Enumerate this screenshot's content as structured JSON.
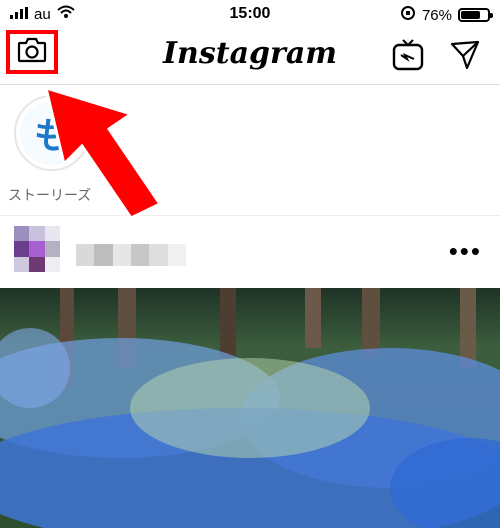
{
  "status_bar": {
    "carrier": "au",
    "time": "15:00",
    "battery_percent": "76%",
    "battery_level": 0.76,
    "icons": [
      "signal-icon",
      "wifi-icon",
      "orientation-lock-icon",
      "battery-icon"
    ]
  },
  "nav": {
    "title": "Instagram",
    "icons": [
      "camera-icon",
      "igtv-icon",
      "direct-message-icon"
    ]
  },
  "stories": {
    "items": [
      {
        "label": "ストーリーズ"
      }
    ]
  },
  "post": {
    "more_label": "•••"
  },
  "colors": {
    "highlight": "#ff0000",
    "story_ring": "#e6e6e6",
    "brand_text": "#1e78c8"
  }
}
